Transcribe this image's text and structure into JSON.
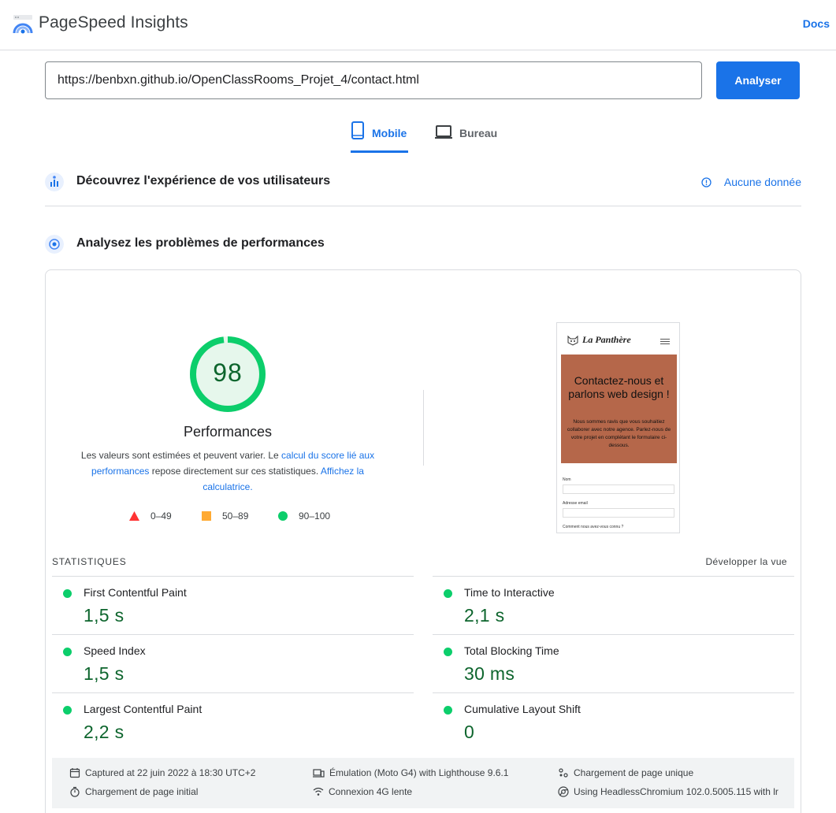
{
  "header": {
    "app_title": "PageSpeed Insights",
    "docs_link": "Docs"
  },
  "search": {
    "url": "https://benbxn.github.io/OpenClassRooms_Projet_4/contact.html",
    "analyze_label": "Analyser"
  },
  "tabs": [
    {
      "label": "Mobile",
      "active": true,
      "icon": "smartphone-icon"
    },
    {
      "label": "Bureau",
      "active": false,
      "icon": "laptop-icon"
    }
  ],
  "field_section": {
    "title": "Découvrez l'expérience de vos utilisateurs",
    "status": "Aucune donnée"
  },
  "lab_section": {
    "title": "Analysez les problèmes de performances"
  },
  "score": {
    "value": "98",
    "fraction": 0.98,
    "label": "Performances",
    "desc_1": "Les valeurs sont estimées et peuvent varier. Le ",
    "desc_link_1": "calcul du score lié aux performances",
    "desc_2": " repose directement sur ces statistiques. ",
    "desc_link_2": "Affichez la calculatrice."
  },
  "legend": [
    {
      "range": "0–49",
      "color": "#ff3333"
    },
    {
      "range": "50–89",
      "color": "#ffaa33"
    },
    {
      "range": "90–100",
      "color": "#0cce6b"
    }
  ],
  "screenshot": {
    "brand": "La Panthère",
    "heading": "Contactez-nous et parlons web design !",
    "body": "Nous sommes ravis que vous souhaitiez collaborer avec notre agence. Parlez-nous de votre projet en complétant le formulaire ci-dessous.",
    "field_1": "Nom",
    "field_2": "Adresse email",
    "field_3": "Comment nous avez-vous connu ?"
  },
  "stats": {
    "title": "STATISTIQUES",
    "expand_label": "Développer la vue",
    "metrics": [
      {
        "name": "First Contentful Paint",
        "value": "1,5 s"
      },
      {
        "name": "Time to Interactive",
        "value": "2,1 s"
      },
      {
        "name": "Speed Index",
        "value": "1,5 s"
      },
      {
        "name": "Total Blocking Time",
        "value": "30 ms"
      },
      {
        "name": "Largest Contentful Paint",
        "value": "2,2 s"
      },
      {
        "name": "Cumulative Layout Shift",
        "value": "0"
      }
    ]
  },
  "run_info": {
    "captured": "Captured at 22 juin 2022 à 18:30 UTC+2",
    "initial_load": "Chargement de page initial",
    "emulation": "Émulation (Moto G4) with Lighthouse 9.6.1",
    "connection": "Connexion 4G lente",
    "single_load": "Chargement de page unique",
    "browser": "Using HeadlessChromium 102.0.5005.115 with lr"
  },
  "colors": {
    "accent": "#1a73e8",
    "pass": "#0cce6b",
    "pass_text": "#0d652d"
  }
}
